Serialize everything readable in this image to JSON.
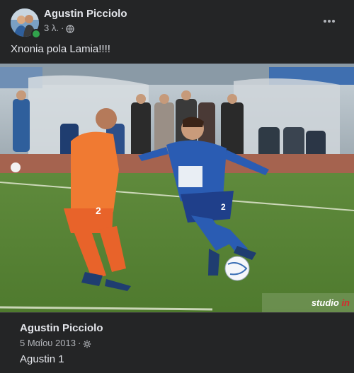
{
  "post": {
    "author": "Agustin Picciolo",
    "time": "3 λ.",
    "separator": "·",
    "privacy_icon": "globe-icon",
    "more_icon": "more-dots-icon",
    "caption": "Xnonia pola Lamia!!!!"
  },
  "photo": {
    "watermark_main": "studio ",
    "watermark_accent": "in",
    "jersey_orange": "2",
    "jersey_blue": "2"
  },
  "shared": {
    "author": "Agustin Picciolo",
    "date": "5 Μαΐου 2013",
    "separator": "·",
    "audience_icon": "gear-icon",
    "text": "Agustin 1"
  },
  "colors": {
    "background": "#242526",
    "text_primary": "#e4e6eb",
    "text_secondary": "#b0b3b8",
    "online": "#31a24c",
    "watermark_accent": "#d9272e"
  }
}
